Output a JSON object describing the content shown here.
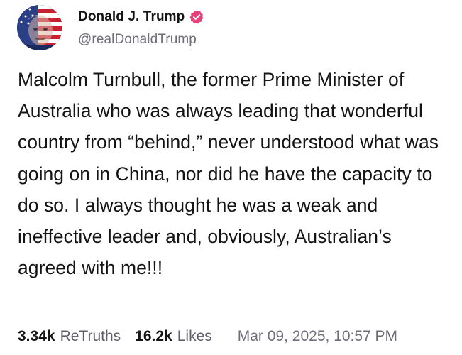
{
  "author": {
    "display_name": "Donald J. Trump",
    "handle": "@realDonaldTrump",
    "avatar_icon": "flag-portrait-avatar",
    "verified_icon": "verified-badge-icon",
    "verified_color": "#e5427b"
  },
  "post": {
    "text": "Malcolm Turnbull, the former Prime Minister of Australia who was always leading that wonderful country from “behind,” never understood what was going on in China, nor did he have the capacity to do so. I always thought he was a weak and ineffective leader and, obviously, Australian’s agreed with me!!!"
  },
  "stats": {
    "retruths_count": "3.34k",
    "retruths_label": "ReTruths",
    "likes_count": "16.2k",
    "likes_label": "Likes",
    "timestamp": "Mar 09, 2025, 10:57 PM"
  }
}
